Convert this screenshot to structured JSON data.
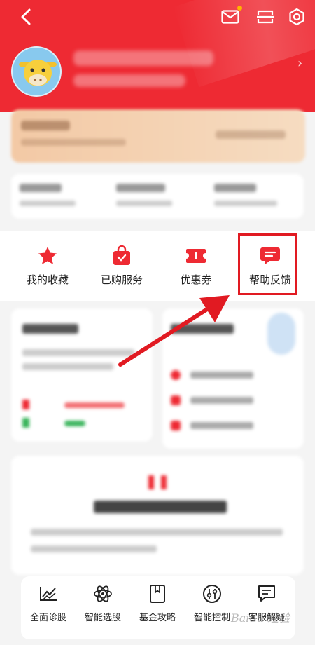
{
  "quick_actions": [
    {
      "label": "我的收藏",
      "icon": "star-icon"
    },
    {
      "label": "已购服务",
      "icon": "shopping-bag-icon"
    },
    {
      "label": "优惠券",
      "icon": "coupon-icon"
    },
    {
      "label": "帮助反馈",
      "icon": "feedback-icon"
    }
  ],
  "bottom_nav": [
    {
      "label": "全面诊股",
      "icon": "chart-diagnosis-icon"
    },
    {
      "label": "智能选股",
      "icon": "atom-icon"
    },
    {
      "label": "基金攻略",
      "icon": "bookmark-book-icon"
    },
    {
      "label": "智能控制",
      "icon": "control-knobs-icon"
    },
    {
      "label": "客服解疑",
      "icon": "message-icon"
    }
  ],
  "watermark": "Baidu 经验",
  "colors": {
    "brand_red": "#ee2a33",
    "highlight_red": "#e11a22",
    "accent": "#ffb400"
  }
}
